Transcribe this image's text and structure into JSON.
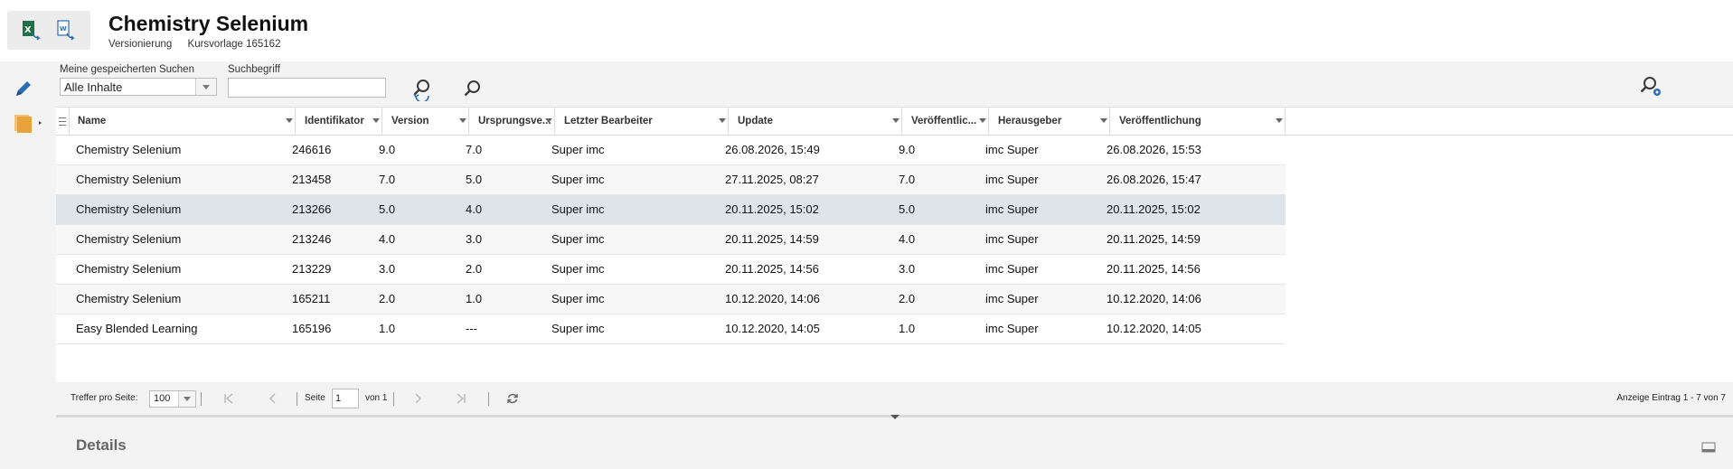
{
  "header": {
    "title": "Chemistry Selenium",
    "breadcrumb": [
      "Versionierung",
      "Kursvorlage 165162"
    ],
    "export_icons": [
      "excel-export-icon",
      "word-export-icon"
    ]
  },
  "sidebar": {
    "icons": [
      "pencil-icon",
      "folders-icon"
    ]
  },
  "filters": {
    "saved_search_label": "Meine gespeicherten Suchen",
    "saved_search_value": "Alle Inhalte",
    "search_label": "Suchbegriff",
    "search_value": "",
    "toolbar_icons": [
      "reset-search-icon",
      "search-icon",
      "search-settings-icon",
      "search-panel-icon"
    ]
  },
  "table": {
    "columns": [
      "Name",
      "Identifikator",
      "Version",
      "Ursprungsve...",
      "Letzter Bearbeiter",
      "Update",
      "Veröffentlic...",
      "Herausgeber",
      "Veröffentlichung"
    ],
    "rows": [
      [
        "Chemistry Selenium",
        "246616",
        "9.0",
        "7.0",
        "Super imc",
        "26.08.2026, 15:49",
        "9.0",
        "imc Super",
        "26.08.2026, 15:53"
      ],
      [
        "Chemistry Selenium",
        "213458",
        "7.0",
        "5.0",
        "Super imc",
        "27.11.2025, 08:27",
        "7.0",
        "imc Super",
        "26.08.2026, 15:47"
      ],
      [
        "Chemistry Selenium",
        "213266",
        "5.0",
        "4.0",
        "Super imc",
        "20.11.2025, 15:02",
        "5.0",
        "imc Super",
        "20.11.2025, 15:02"
      ],
      [
        "Chemistry Selenium",
        "213246",
        "4.0",
        "3.0",
        "Super imc",
        "20.11.2025, 14:59",
        "4.0",
        "imc Super",
        "20.11.2025, 14:59"
      ],
      [
        "Chemistry Selenium",
        "213229",
        "3.0",
        "2.0",
        "Super imc",
        "20.11.2025, 14:56",
        "3.0",
        "imc Super",
        "20.11.2025, 14:56"
      ],
      [
        "Chemistry Selenium",
        "165211",
        "2.0",
        "1.0",
        "Super imc",
        "10.12.2020, 14:06",
        "2.0",
        "imc Super",
        "10.12.2020, 14:06"
      ],
      [
        "Easy Blended Learning",
        "165196",
        "1.0",
        "---",
        "Super imc",
        "10.12.2020, 14:05",
        "1.0",
        "imc Super",
        "10.12.2020, 14:05"
      ]
    ],
    "selected_row": 2
  },
  "pager": {
    "per_page_label": "Treffer pro Seite:",
    "per_page_value": "100",
    "page_label": "Seite",
    "page_value": "1",
    "of_label": "von 1",
    "summary": "Anzeige Eintrag 1 - 7 von 7"
  },
  "details": {
    "title": "Details"
  },
  "colors": {
    "selected_row": "#dde5eb",
    "icon_blue": "#2d6fb3",
    "folder_orange": "#e8a33b",
    "excel_green": "#1e7145"
  }
}
